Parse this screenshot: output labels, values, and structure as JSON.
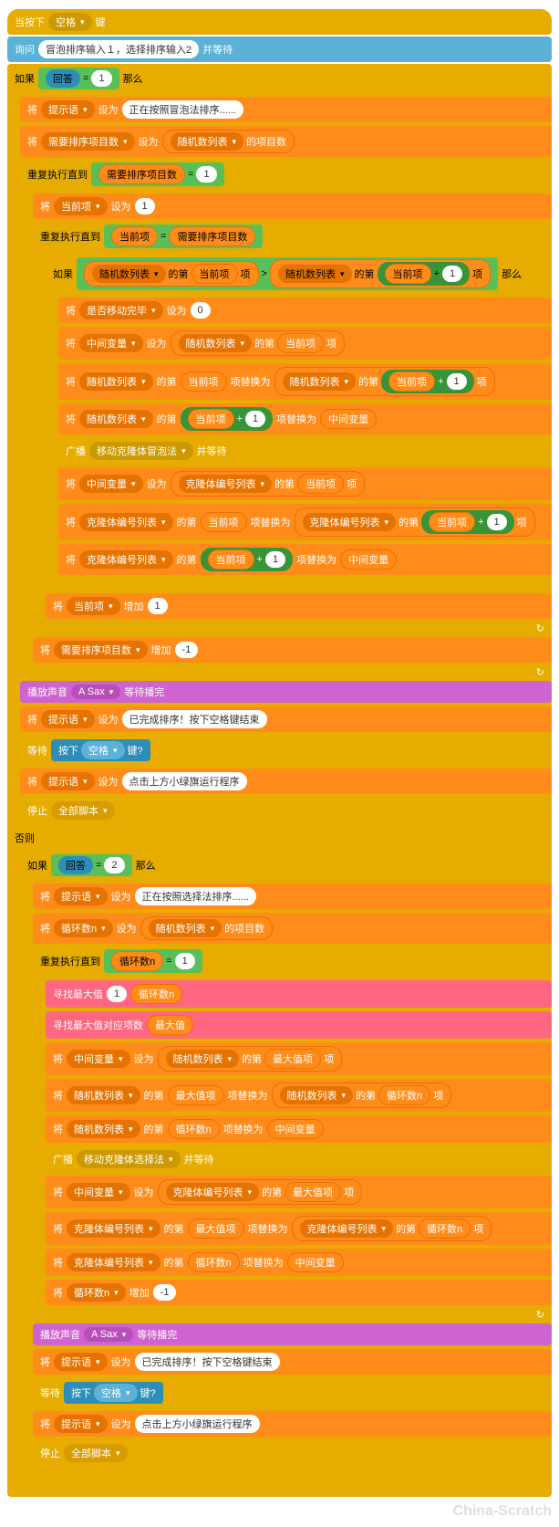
{
  "hat": {
    "when": "当按下",
    "key": "空格",
    "keyword": "键"
  },
  "ask": {
    "cmd": "询问",
    "text": "冒泡排序输入１，选择排序输入2",
    "wait": "并等待"
  },
  "if1": {
    "if": "如果",
    "then": "那么",
    "else": "否则"
  },
  "answer": "回答",
  "eq": "=",
  "one": "1",
  "two": "2",
  "set": "将",
  "to": "设为",
  "add": "增加",
  "tip": "提示语",
  "bubble_msg": "正在按照冒泡法排序......",
  "select_msg": "正在按照选择法排序......",
  "needSort": "需要排序项目数",
  "list": "随机数列表",
  "itemCount": "的项目数",
  "repeatUntil": "重复执行直到",
  "current": "当前项",
  "itemOf": "的第",
  "item": "项",
  "gt": ">",
  "plus": "+",
  "moveDone": "是否移动完毕",
  "zero": "0",
  "temp": "中间变量",
  "replace": "项替换为",
  "broadcast": "广播",
  "andWait": "并等待",
  "moveBubble": "移动克隆体冒泡法",
  "moveSelect": "移动克隆体选择法",
  "cloneList": "克隆体编号列表",
  "neg1": "-1",
  "play": "播放声音",
  "playWait": "等待播完",
  "sax": "A Sax",
  "done": "已完成排序！按下空格键结束",
  "waitUntil": "等待",
  "keyPressed": {
    "pre": "按下",
    "key": "空格",
    "post": "键?"
  },
  "clickFlag": "点击上方小绿旗运行程序",
  "stop": "停止",
  "stopAll": "全部脚本",
  "loopN": "循环数n",
  "findMax": "寻找最大值",
  "findMaxIdx": "寻找最大值对应项数",
  "maxVal": "最大值",
  "maxIdx": "最大值项",
  "watermark": "China-Scratch"
}
